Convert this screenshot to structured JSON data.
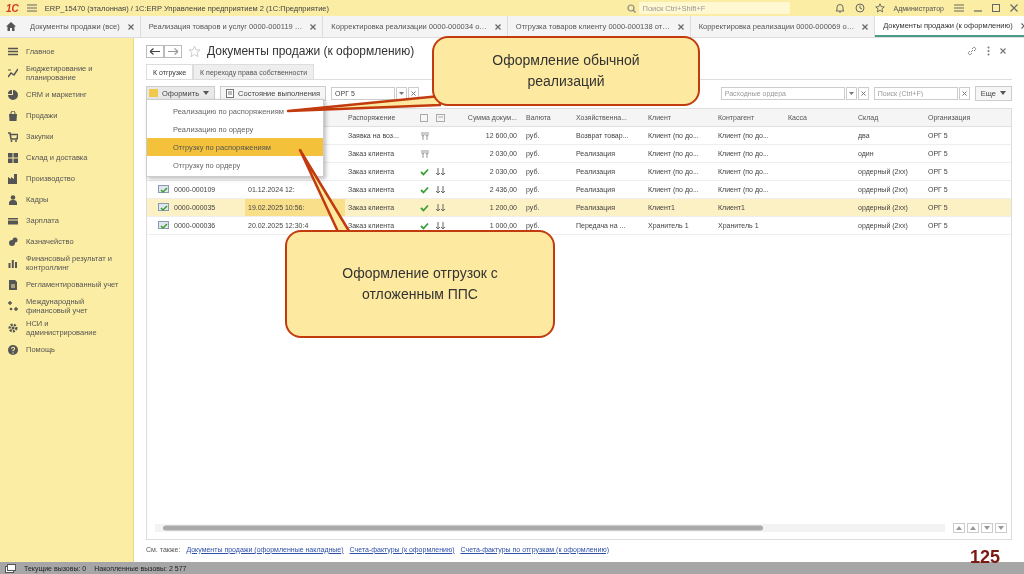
{
  "window": {
    "logo": "1С",
    "title": "ERP_15470 (эталонная) / 1С:ERP Управление предприятием 2  (1С:Предприятие)",
    "search_placeholder": "Поиск Ctrl+Shift+F",
    "user": "Администратор"
  },
  "open_tabs": [
    {
      "label": "Документы продажи (все)",
      "selected": false
    },
    {
      "label": "Реализация товаров и услуг 0000-000119 …",
      "selected": false
    },
    {
      "label": "Корректировка реализации 0000-000034 о…",
      "selected": false
    },
    {
      "label": "Отгрузка товаров клиенту 0000-000138 от…",
      "selected": false
    },
    {
      "label": "Корректировка реализации 0000-000069 о…",
      "selected": false
    },
    {
      "label": "Документы продажи (к оформлению)",
      "selected": true
    }
  ],
  "sidebar": {
    "items": [
      {
        "label": "Главное"
      },
      {
        "label": "Бюджетирование и планирование"
      },
      {
        "label": "CRM и маркетинг"
      },
      {
        "label": "Продажи"
      },
      {
        "label": "Закупки"
      },
      {
        "label": "Склад и доставка"
      },
      {
        "label": "Производство"
      },
      {
        "label": "Кадры"
      },
      {
        "label": "Зарплата"
      },
      {
        "label": "Казначейство"
      },
      {
        "label": "Финансовый результат и контроллинг"
      },
      {
        "label": "Регламентированный учет"
      },
      {
        "label": "Международный финансовый учет"
      },
      {
        "label": "НСИ и администрирование"
      },
      {
        "label": "Помощь"
      }
    ]
  },
  "form": {
    "title": "Документы продажи (к оформлению)",
    "tabs": [
      {
        "label": "К отгрузке",
        "selected": true
      },
      {
        "label": "К переходу права собственности",
        "selected": false
      }
    ],
    "toolbar": {
      "create_button": "Оформить",
      "status_button": "Состояние выполнения",
      "organization": "ОРГ 5",
      "orders_placeholder": "Расходные ордера",
      "search_placeholder": "Поиск (Ctrl+F)",
      "more_button": "Еще"
    },
    "create_menu": [
      {
        "label": "Реализацию по распоряжениям",
        "selected": false
      },
      {
        "label": "Реализацию по ордеру",
        "selected": false
      },
      {
        "label": "Отгрузку по распоряжениям",
        "selected": true
      },
      {
        "label": "Отгрузку по ордеру",
        "selected": false
      }
    ],
    "table": {
      "columns": [
        "Распоряжение",
        "Сумма докум...",
        "Валюта",
        "Хозяйственна...",
        "Клиент",
        "Контрагент",
        "Касса",
        "Склад",
        "Организация"
      ],
      "rows": [
        {
          "order": "Заявка на воз...",
          "kind": "pending",
          "sum": "12 600,00",
          "currency": "руб.",
          "operation": "Возврат товар...",
          "client": "Клиент (по до...",
          "counterparty": "Клиент (по до...",
          "warehouse": "два",
          "organization": "ОРГ 5",
          "selected": false
        },
        {
          "order": "Заказ клиента",
          "kind": "pending",
          "sum": "2 030,00",
          "currency": "руб.",
          "operation": "Реализация",
          "client": "Клиент (по до...",
          "counterparty": "Клиент (по до...",
          "warehouse": "один",
          "organization": "ОРГ 5",
          "selected": false
        },
        {
          "order": "Заказ клиента",
          "kind": "done",
          "sum": "2 030,00",
          "currency": "руб.",
          "operation": "Реализация",
          "client": "Клиент (по до...",
          "counterparty": "Клиент (по до...",
          "warehouse": "ордерный (2xx)",
          "organization": "ОРГ 5",
          "selected": false
        },
        {
          "number": "0000-000109",
          "date": "01.12.2024 12:",
          "order": "Заказ клиента",
          "kind": "done",
          "sum": "2 436,00",
          "currency": "руб.",
          "operation": "Реализация",
          "client": "Клиент (по до...",
          "counterparty": "Клиент (по до...",
          "warehouse": "ордерный (2xx)",
          "organization": "ОРГ 5",
          "selected": false
        },
        {
          "number": "0000-000035",
          "date": "19.02.2025 10:56:",
          "order": "Заказ клиента",
          "kind": "done",
          "sum": "1 200,00",
          "currency": "руб.",
          "operation": "Реализация",
          "client": "Клиент1",
          "counterparty": "Клиент1",
          "warehouse": "ордерный (2xx)",
          "organization": "ОРГ 5",
          "selected": true
        },
        {
          "number": "0000-000036",
          "date": "20.02.2025 12:30:4",
          "order": "Заказ клиента",
          "kind": "done",
          "sum": "1 000,00",
          "currency": "руб.",
          "operation": "Передача на ...",
          "client": "Хранитель 1",
          "counterparty": "Хранитель 1",
          "warehouse": "ордерный (2xx)",
          "organization": "ОРГ 5",
          "selected": false
        }
      ]
    },
    "see_also": {
      "label": "См. также:",
      "links": [
        "Документы продажи (оформленные накладные)",
        "Счета-фактуры (к оформлению)",
        "Счета-фактуры по отгрузкам (к оформлению)"
      ]
    }
  },
  "status_bar": {
    "current_calls": "Текущие вызовы: 0",
    "total_calls": "Накопленные вызовы: 2 577"
  },
  "callouts": [
    {
      "text": "Оформление обычной реализаций"
    },
    {
      "text": "Оформление отгрузок с отложенным ППС"
    }
  ],
  "slide_number": "125"
}
